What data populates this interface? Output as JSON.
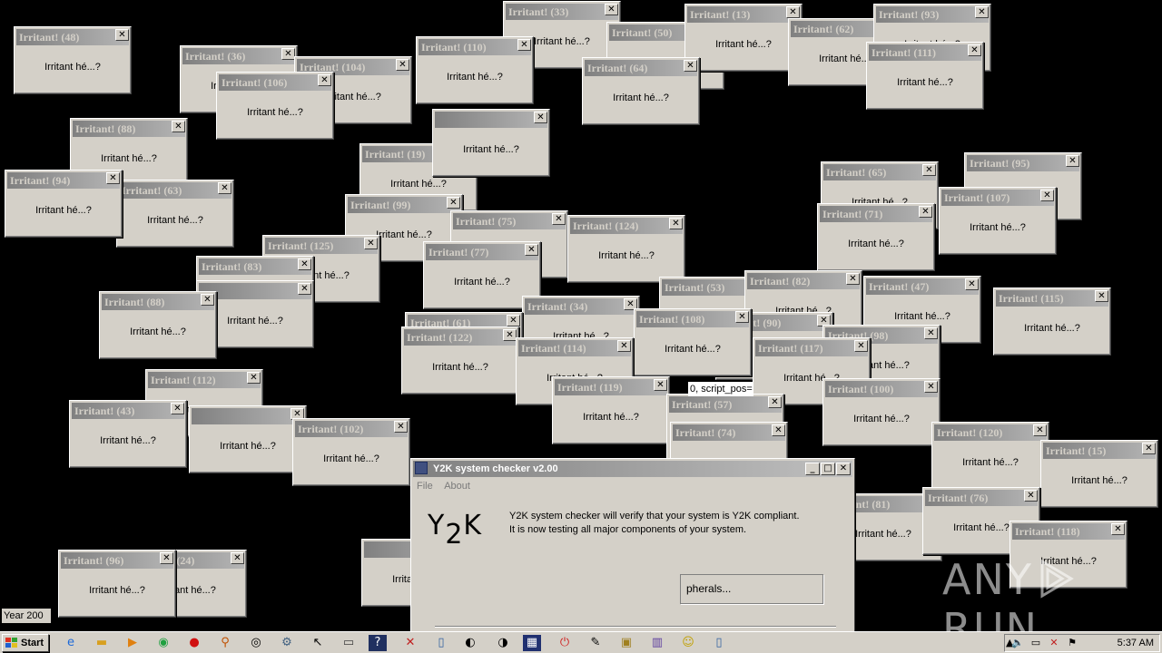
{
  "popup_message": "Irritant hé...?",
  "close_glyph": "✕",
  "popups": [
    {
      "title": "Irritant! (48)"
    },
    {
      "title": "Irritant! (36)"
    },
    {
      "title": "Irritant! (104)"
    },
    {
      "title": "Irritant! (106)"
    },
    {
      "title": "Irritant! (33)"
    },
    {
      "title": "Irritant! (110)"
    },
    {
      "title": "Irritant! (50)"
    },
    {
      "title": "Irritant! (13)"
    },
    {
      "title": "Irritant! (64)"
    },
    {
      "title": "Irritant! (62)"
    },
    {
      "title": "Irritant! (93)"
    },
    {
      "title": "Irritant! (111)"
    },
    {
      "title": "Irritant! (88)"
    },
    {
      "title": "Irritant! (94)"
    },
    {
      "title": "Irritant! (63)"
    },
    {
      "title": "Irritant! (19)"
    },
    {
      "title": "Irritant! (99)"
    },
    {
      "title": "Irritant! (75)"
    },
    {
      "title": "Irritant! (77)"
    },
    {
      "title": "Irritant! (125)"
    },
    {
      "title": "Irritant! (124)"
    },
    {
      "title": "Irritant! (65)"
    },
    {
      "title": "Irritant! (95)"
    },
    {
      "title": "Irritant! (71)"
    },
    {
      "title": "Irritant! (107)"
    },
    {
      "title": "Irritant! (83)"
    },
    {
      "title": "Irritant! (53)"
    },
    {
      "title": "Irritant! (82)"
    },
    {
      "title": "Irritant! (47)"
    },
    {
      "title": "Irritant! (115)"
    },
    {
      "title": "Irritant! (34)"
    },
    {
      "title": "Irritant! (61)"
    },
    {
      "title": "Irritant! (122)"
    },
    {
      "title": "Irritant! (108)"
    },
    {
      "title": "Irritant! (90)"
    },
    {
      "title": "Irritant! (98)"
    },
    {
      "title": "Irritant! (114)"
    },
    {
      "title": "Irritant! (117)"
    },
    {
      "title": "Irritant! (88)"
    },
    {
      "title": "Irritant! (112)"
    },
    {
      "title": "Irritant! (100)"
    },
    {
      "title": "Irritant! (119)"
    },
    {
      "title": "Irritant! (43)"
    },
    {
      "title": "Irritant! (57)"
    },
    {
      "title": "Irritant! (102)"
    },
    {
      "title": "Irritant! (74)"
    },
    {
      "title": "Irritant! (120)"
    },
    {
      "title": "Irritant! (15)"
    },
    {
      "title": "Irritant! (81)"
    },
    {
      "title": "Irritant! (76)"
    },
    {
      "title": "Irritant! (118)"
    },
    {
      "title": "Irritant! (24)"
    },
    {
      "title": "Irritant! (96)"
    }
  ],
  "y2k_window": {
    "title": "Y2K system checker v2.00",
    "menu": [
      "File",
      "About"
    ],
    "logo_left": "Y",
    "logo_sub": "2",
    "logo_right": "K",
    "desc_line1": "Y2K system checker will verify that your system is Y2K compliant.",
    "desc_line2": "It is now testing all major components of your system.",
    "status": "pherals..."
  },
  "fragments": {
    "script_pos": "0, script_pos=",
    "year": "Year 200"
  },
  "taskbar": {
    "start_label": "Start",
    "clock": "5:37 AM",
    "icons": [
      "ie-icon",
      "folder-icon",
      "media-icon",
      "chrome-icon",
      "opera-icon",
      "search-icon",
      "eye-icon",
      "tool-icon",
      "cursor-icon",
      "window-icon",
      "faq-icon",
      "network-icon",
      "doc-icon",
      "moon-icon",
      "moon2-icon",
      "computer-icon",
      "power-icon",
      "edit-icon",
      "gift-icon",
      "book-icon",
      "smile-icon",
      "page-icon"
    ]
  },
  "watermark": {
    "left": "ANY",
    "right": "RUN"
  }
}
